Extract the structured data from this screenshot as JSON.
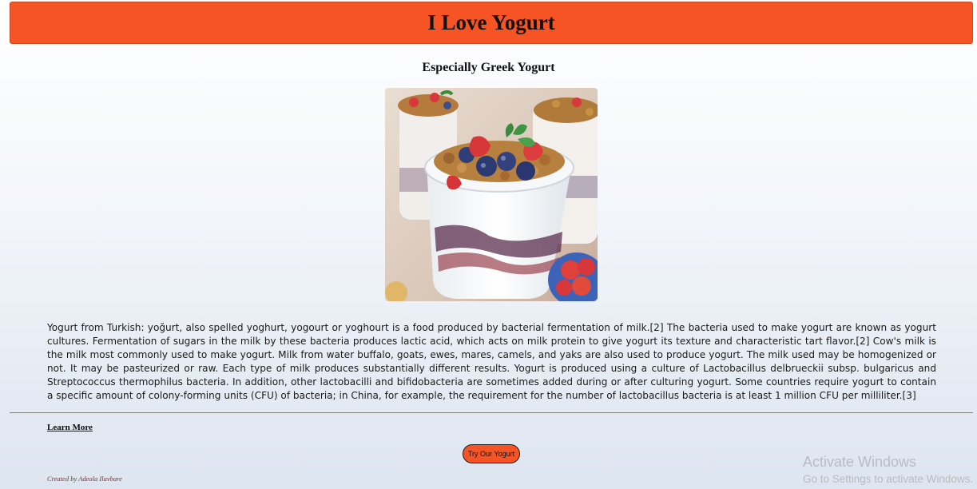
{
  "header": {
    "title": "I Love Yogurt",
    "bg_color": "#f75426"
  },
  "main": {
    "subtitle": "Especially Greek Yogurt",
    "image": {
      "subject": "yogurt parfait jars topped with granola, blueberries, strawberries and mint"
    },
    "paragraph": "Yogurt from Turkish: yoğurt, also spelled yoghurt, yogourt or yoghourt is a food produced by bacterial fermentation of milk.[2] The bacteria used to make yogurt are known as yogurt cultures. Fermentation of sugars in the milk by these bacteria produces lactic acid, which acts on milk protein to give yogurt its texture and characteristic tart flavor.[2] Cow's milk is the milk most commonly used to make yogurt. Milk from water buffalo, goats, ewes, mares, camels, and yaks are also used to produce yogurt. The milk used may be homogenized or not. It may be pasteurized or raw. Each type of milk produces substantially different results. Yogurt is produced using a culture of Lactobacillus delbrueckii subsp. bulgaricus and Streptococcus thermophilus bacteria. In addition, other lactobacilli and bifidobacteria are sometimes added during or after culturing yogurt. Some countries require yogurt to contain a specific amount of colony-forming units (CFU) of bacteria; in China, for example, the requirement for the number of lactobacillus bacteria is at least 1 million CFU per milliliter.[3]"
  },
  "links": {
    "learn_more": "Learn More"
  },
  "cta": {
    "button_label": "Try Our Yogurt",
    "bg_color": "#f75426"
  },
  "footer": {
    "credit": "Created by Adeola Ilavbare"
  },
  "os_watermark": {
    "title": "Activate Windows",
    "subtitle": "Go to Settings to activate Windows."
  }
}
